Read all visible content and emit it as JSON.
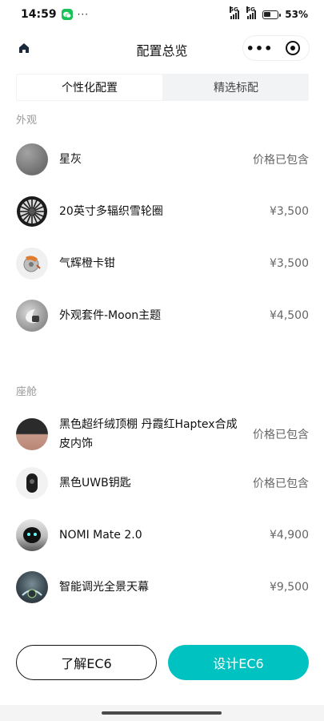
{
  "status_bar": {
    "time": "14:59",
    "more": "···",
    "signal1": "5G",
    "signal2": "5G",
    "battery": "53%"
  },
  "nav": {
    "title": "配置总览",
    "more": "•••"
  },
  "tabs": [
    {
      "label": "个性化配置",
      "active": true
    },
    {
      "label": "精选标配",
      "active": false
    }
  ],
  "sections": [
    {
      "label": "外观",
      "items": [
        {
          "name": "星灰",
          "price": "价格已包含",
          "icon": "paint-swatch-icon"
        },
        {
          "name": "20英寸多辐织雪轮圈",
          "price": "¥3,500",
          "icon": "wheel-icon"
        },
        {
          "name": "气辉橙卡钳",
          "price": "¥3,500",
          "icon": "caliper-icon"
        },
        {
          "name": "外观套件-Moon主题",
          "price": "¥4,500",
          "icon": "exterior-kit-icon"
        }
      ]
    },
    {
      "label": "座舱",
      "items": [
        {
          "name": "黑色超纤绒顶棚 丹霞红Haptex合成皮内饰",
          "price": "价格已包含",
          "icon": "interior-icon"
        },
        {
          "name": "黑色UWB钥匙",
          "price": "价格已包含",
          "icon": "key-fob-icon"
        },
        {
          "name": "NOMI Mate 2.0",
          "price": "¥4,900",
          "icon": "nomi-icon"
        },
        {
          "name": "智能调光全景天幕",
          "price": "¥9,500",
          "icon": "sunroof-icon"
        }
      ]
    }
  ],
  "buttons": {
    "learn": "了解EC6",
    "design": "设计EC6"
  },
  "colors": {
    "accent": "#00c2c0",
    "section_label": "#999999",
    "tab_bg": "#f2f3f5"
  }
}
